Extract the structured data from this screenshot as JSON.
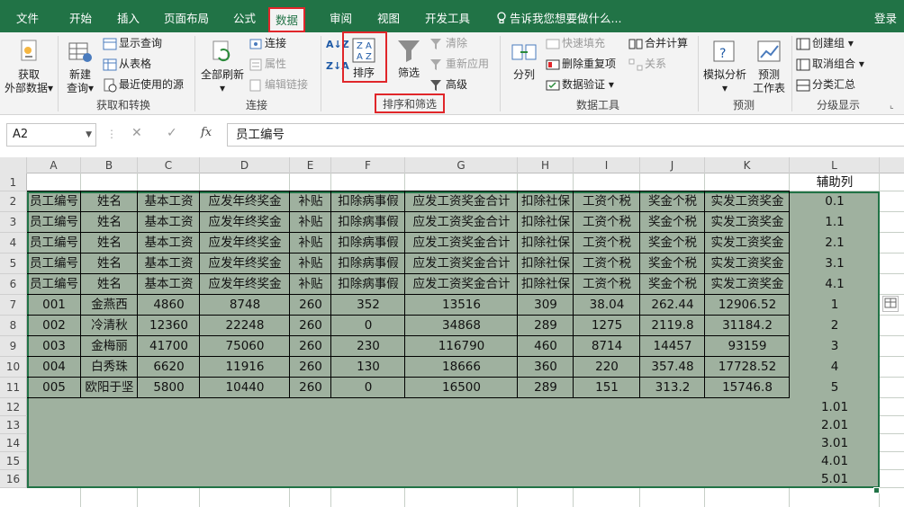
{
  "tabs": {
    "file": "文件",
    "home": "开始",
    "insert": "插入",
    "layout": "页面布局",
    "formulas": "公式",
    "data": "数据",
    "review": "审阅",
    "view": "视图",
    "developer": "开发工具",
    "tell": "告诉我您想要做什么...",
    "login": "登录"
  },
  "ribbon": {
    "get_data": {
      "btn": "获取",
      "btn2": "外部数据"
    },
    "new_query": {
      "btn": "新建",
      "btn2": "查询"
    },
    "show_query": "显示查询",
    "from_table": "从表格",
    "recent": "最近使用的源",
    "group_get": "获取和转换",
    "refresh_all": "全部刷新",
    "connections": "连接",
    "properties": "属性",
    "edit_links": "编辑链接",
    "group_conn": "连接",
    "sort": "排序",
    "filter": "筛选",
    "clear": "清除",
    "reapply": "重新应用",
    "advanced": "高级",
    "group_sort": "排序和筛选",
    "split": "分列",
    "flash_fill": "快速填充",
    "remove_dup": "删除重复项",
    "validation": "数据验证",
    "consolidate": "合并计算",
    "relations": "关系",
    "group_tools": "数据工具",
    "whatif": "模拟分析",
    "forecast": "预测",
    "forecast2": "工作表",
    "group_forecast": "预测",
    "group": "创建组",
    "ungroup": "取消组合",
    "subtotal": "分类汇总",
    "group_outline": "分级显示"
  },
  "formula_bar": {
    "name_box": "A2",
    "formula": "员工编号",
    "fx": "fx"
  },
  "columns": [
    "A",
    "B",
    "C",
    "D",
    "E",
    "F",
    "G",
    "H",
    "I",
    "J",
    "K",
    "L"
  ],
  "rows": [
    "1",
    "2",
    "3",
    "4",
    "5",
    "6",
    "7",
    "8",
    "9",
    "10",
    "11",
    "12",
    "13",
    "14",
    "15",
    "16"
  ],
  "header_row": [
    "员工编号",
    "姓名",
    "基本工资",
    "应发年终奖金",
    "补贴",
    "扣除病事假",
    "应发工资奖金合计",
    "扣除社保",
    "工资个税",
    "奖金个税",
    "实发工资奖金"
  ],
  "helper_title": "辅助列",
  "helper": [
    "0.1",
    "1.1",
    "2.1",
    "3.1",
    "4.1",
    "1",
    "2",
    "3",
    "4",
    "5",
    "1.01",
    "2.01",
    "3.01",
    "4.01",
    "5.01"
  ],
  "data_rows": [
    [
      "001",
      "金燕西",
      "4860",
      "8748",
      "260",
      "352",
      "13516",
      "309",
      "38.04",
      "262.44",
      "12906.52"
    ],
    [
      "002",
      "冷清秋",
      "12360",
      "22248",
      "260",
      "0",
      "34868",
      "289",
      "1275",
      "2119.8",
      "31184.2"
    ],
    [
      "003",
      "金梅丽",
      "41700",
      "75060",
      "260",
      "230",
      "116790",
      "460",
      "8714",
      "14457",
      "93159"
    ],
    [
      "004",
      "白秀珠",
      "6620",
      "11916",
      "260",
      "130",
      "18666",
      "360",
      "220",
      "357.48",
      "17728.52"
    ],
    [
      "005",
      "欧阳于坚",
      "5800",
      "10440",
      "260",
      "0",
      "16500",
      "289",
      "151",
      "313.2",
      "15746.8"
    ]
  ],
  "colors": {
    "brand": "#217346",
    "highlight": "#e0262a",
    "selection": "#9fb19f"
  }
}
